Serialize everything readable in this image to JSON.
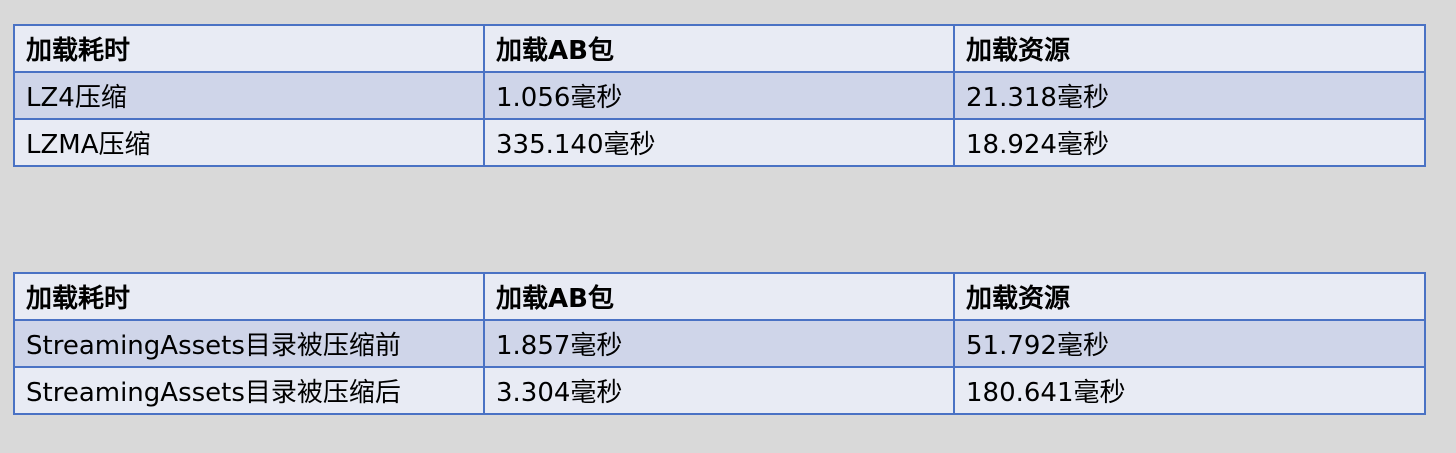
{
  "tables": [
    {
      "headers": [
        "加载耗时",
        "加载AB包",
        "加载资源"
      ],
      "rows": [
        [
          "LZ4压缩",
          "1.056毫秒",
          "21.318毫秒"
        ],
        [
          "LZMA压缩",
          "335.140毫秒",
          "18.924毫秒"
        ]
      ]
    },
    {
      "headers": [
        "加载耗时",
        "加载AB包",
        "加载资源"
      ],
      "rows": [
        [
          "StreamingAssets目录被压缩前",
          "1.857毫秒",
          "51.792毫秒"
        ],
        [
          "StreamingAssets目录被压缩后",
          "3.304毫秒",
          "180.641毫秒"
        ]
      ]
    }
  ],
  "colors": {
    "background": "#d9d9d9",
    "border": "#4a72c4",
    "row_shaded": "#cfd5e9",
    "row_light": "#e8ebf4"
  }
}
